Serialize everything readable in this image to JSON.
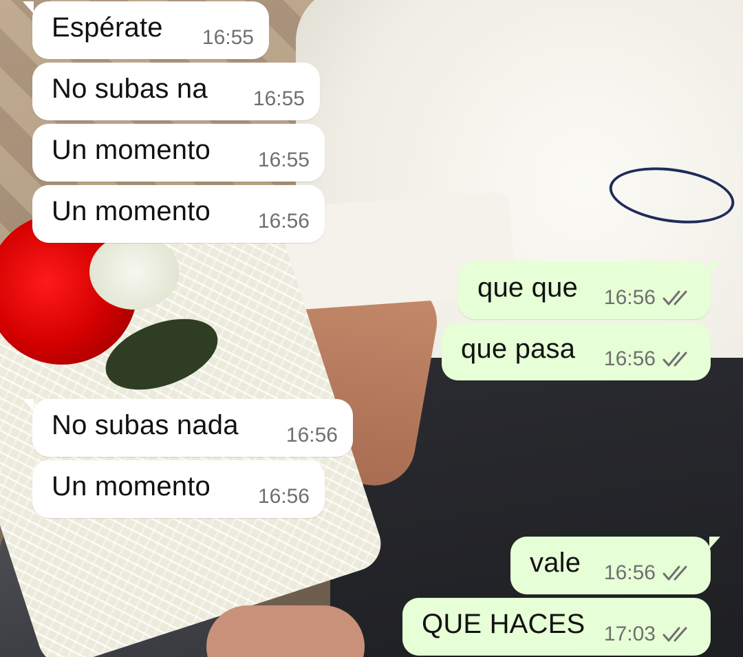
{
  "messages": [
    {
      "direction": "incoming",
      "text": "Espérate",
      "time": "16:55"
    },
    {
      "direction": "incoming",
      "text": "No subas na",
      "time": "16:55"
    },
    {
      "direction": "incoming",
      "text": "Un momento",
      "time": "16:55"
    },
    {
      "direction": "incoming",
      "text": "Un momento",
      "time": "16:56"
    },
    {
      "direction": "outgoing",
      "text": "que que",
      "time": "16:56",
      "status": "read-ticks-icon"
    },
    {
      "direction": "outgoing",
      "text": "que pasa",
      "time": "16:56",
      "status": "read-ticks-icon"
    },
    {
      "direction": "incoming",
      "text": "No subas nada",
      "time": "16:56"
    },
    {
      "direction": "incoming",
      "text": "Un momento",
      "time": "16:56"
    },
    {
      "direction": "outgoing",
      "text": "vale",
      "time": "16:56",
      "status": "read-ticks-icon"
    },
    {
      "direction": "outgoing",
      "text": "QUE HACES",
      "time": "17:03",
      "status": "read-ticks-icon"
    }
  ],
  "colors": {
    "incoming_bubble": "#ffffff",
    "outgoing_bubble": "#e6ffd6",
    "timestamp": "#6f6f6f",
    "ticks": "#6f6f6f"
  }
}
